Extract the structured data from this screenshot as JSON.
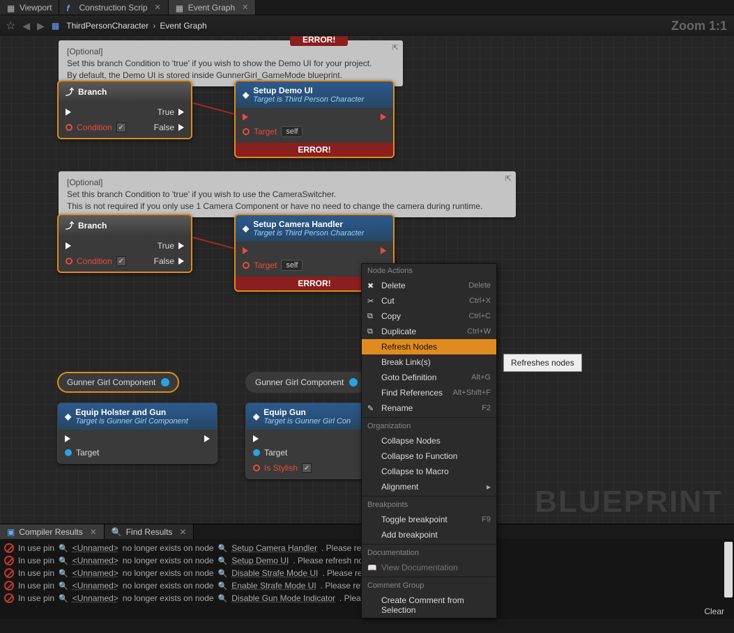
{
  "tabs": {
    "viewport": "Viewport",
    "construction": "Construction Scrip",
    "eventgraph": "Event Graph"
  },
  "breadcrumb": {
    "root": "ThirdPersonCharacter",
    "leaf": "Event Graph"
  },
  "zoom": "Zoom 1:1",
  "error_chip": "ERROR!",
  "comment1": {
    "opt": "[Optional]",
    "l1": "Set this branch Condition to 'true' if you wish to show the Demo UI for your project.",
    "l2": "By default, the Demo UI is stored inside GunnerGirl_GameMode blueprint."
  },
  "comment2": {
    "opt": "[Optional]",
    "l1": "Set this branch Condition to 'true' if you wish to use the CameraSwitcher.",
    "l2": "This is not required if you only use 1 Camera Component or have no need to change the camera during runtime."
  },
  "branch_node": {
    "title": "Branch",
    "true": "True",
    "false": "False",
    "condition": "Condition"
  },
  "setup_demo": {
    "title": "Setup Demo UI",
    "sub": "Target is Third Person Character",
    "target": "Target",
    "self": "self",
    "err": "ERROR!"
  },
  "setup_cam": {
    "title": "Setup Camera Handler",
    "sub": "Target is Third Person Character",
    "target": "Target",
    "self": "self",
    "err": "ERROR!"
  },
  "pill_ggc": "Gunner Girl Component",
  "equip_hg": {
    "title": "Equip Holster and Gun",
    "sub": "Target is Gunner Girl Component",
    "target": "Target"
  },
  "equip_gun": {
    "title": "Equip Gun",
    "sub": "Target is Gunner Girl Con",
    "target": "Target",
    "stylish": "Is Stylish"
  },
  "watermark": "BLUEPRINT",
  "ctx": {
    "h1": "Node Actions",
    "delete": "Delete",
    "delete_sc": "Delete",
    "cut": "Cut",
    "cut_sc": "Ctrl+X",
    "copy": "Copy",
    "copy_sc": "Ctrl+C",
    "dup": "Duplicate",
    "dup_sc": "Ctrl+W",
    "refresh": "Refresh Nodes",
    "break": "Break Link(s)",
    "goto": "Goto Definition",
    "goto_sc": "Alt+G",
    "findref": "Find References",
    "findref_sc": "Alt+Shift+F",
    "rename": "Rename",
    "rename_sc": "F2",
    "h2": "Organization",
    "collapse_nodes": "Collapse Nodes",
    "collapse_func": "Collapse to Function",
    "collapse_macro": "Collapse to Macro",
    "alignment": "Alignment",
    "h3": "Breakpoints",
    "toggle_bp": "Toggle breakpoint",
    "toggle_bp_sc": "F9",
    "add_bp": "Add breakpoint",
    "h4": "Documentation",
    "view_doc": "View Documentation",
    "h5": "Comment Group",
    "create_comment": "Create Comment from Selection"
  },
  "tooltip": "Refreshes nodes",
  "bottom_tabs": {
    "compiler": "Compiler Results",
    "find": "Find Results"
  },
  "results": {
    "prefix": "In use pin ",
    "unnamed": "<Unnamed>",
    "mid": "  no longer exists on node ",
    "suffix_refresh": " . Please refresh",
    "suffix_refresh_node": " . Please refresh node c",
    "r1_node": "Setup Camera Handler",
    "r2_node": "Setup Demo UI",
    "r3_node": "Disable Strafe Mode UI",
    "r4_node": "Enable Strafe Mode UI",
    "r5_node": "Disable Gun Mode Indicator",
    "r5_suffix": " . Please re"
  },
  "clear": "Clear"
}
